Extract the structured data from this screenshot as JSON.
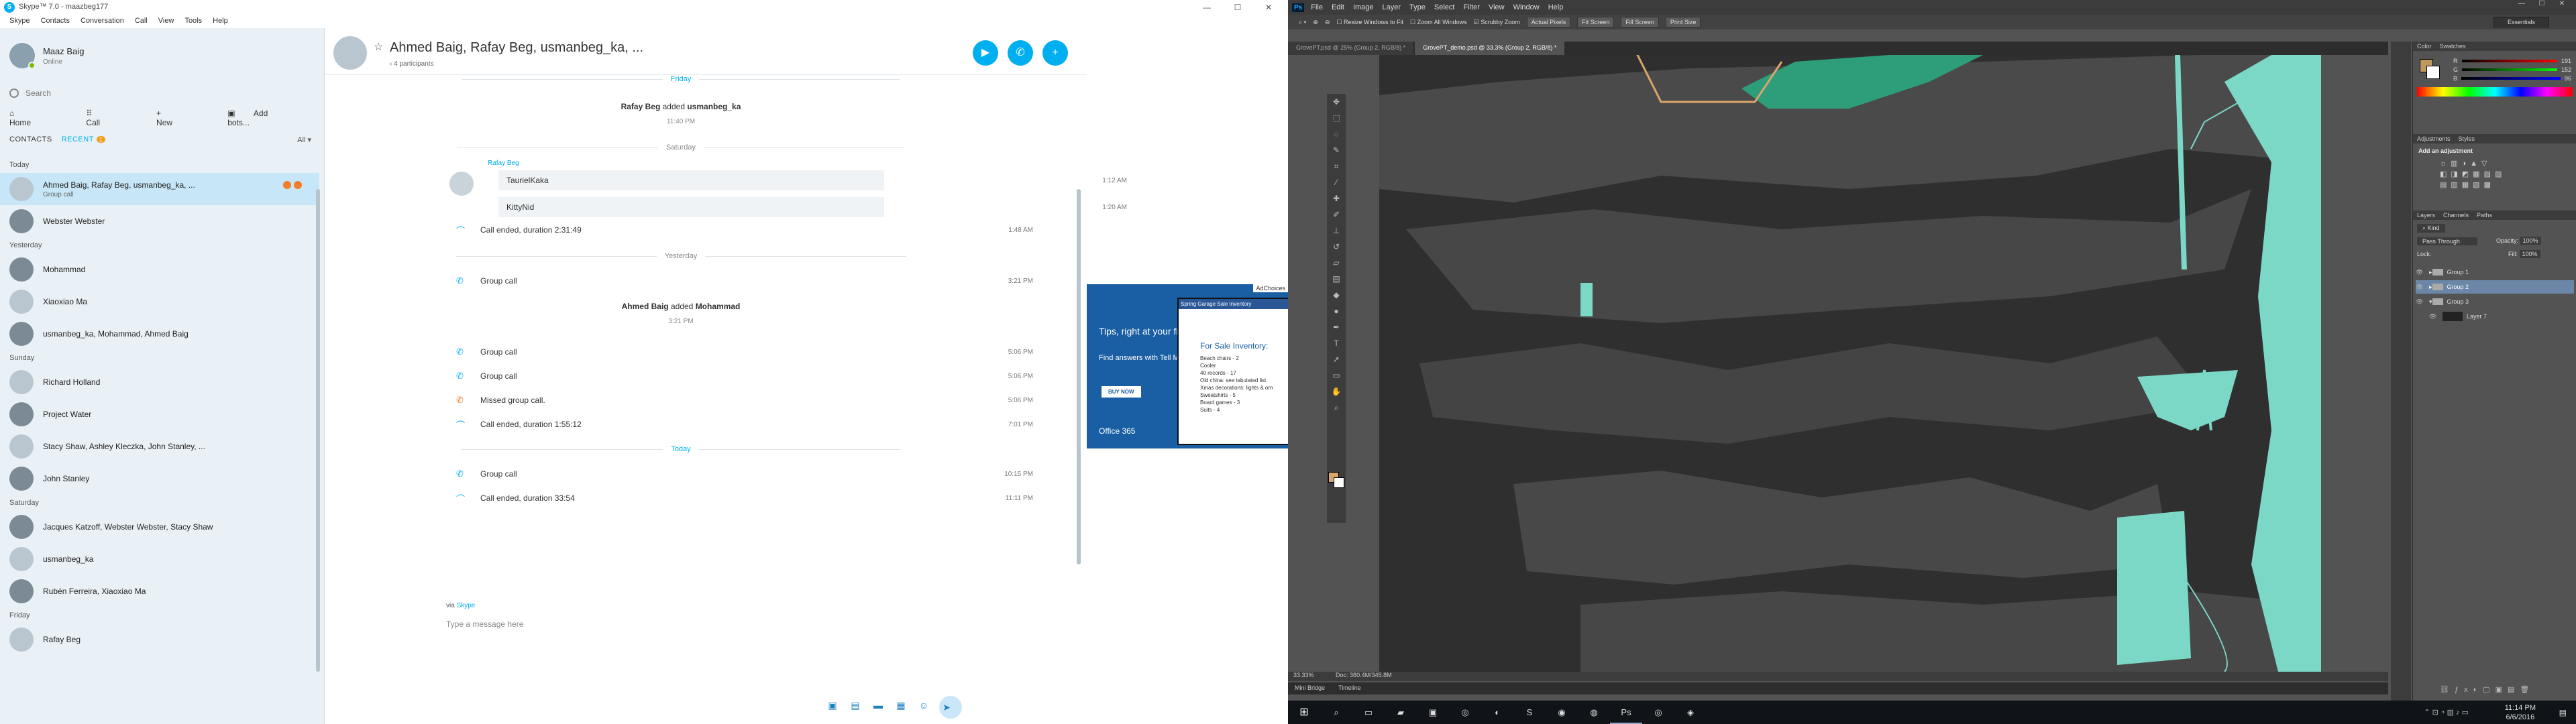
{
  "skype": {
    "window_title": "Skype™ 7.0 - maazbeg177",
    "menu": [
      "Skype",
      "Contacts",
      "Conversation",
      "Call",
      "View",
      "Tools",
      "Help"
    ],
    "profile": {
      "name": "Maaz Baig",
      "status": "Online"
    },
    "search_placeholder": "Search",
    "nav": {
      "home": "Home",
      "call": "Call",
      "new": "New",
      "add_bots": "Add bots..."
    },
    "tabs": {
      "contacts": "CONTACTS",
      "recent": "RECENT",
      "recent_count": "1",
      "filter": "All"
    },
    "sections": [
      {
        "label": "Today",
        "items": [
          {
            "name": "Ahmed Baig, Rafay Beg, usmanbeg_ka, ...",
            "sub": "Group call",
            "selected": true
          },
          {
            "name": "Webster Webster",
            "sub": ""
          }
        ]
      },
      {
        "label": "Yesterday",
        "items": [
          {
            "name": "Mohammad",
            "sub": ""
          },
          {
            "name": "Xiaoxiao Ma",
            "sub": ""
          },
          {
            "name": "usmanbeg_ka, Mohammad, Ahmed Baig",
            "sub": ""
          }
        ]
      },
      {
        "label": "Sunday",
        "items": [
          {
            "name": "Richard Holland",
            "sub": ""
          },
          {
            "name": "Project Water",
            "sub": ""
          },
          {
            "name": "Stacy Shaw, Ashley Kleczka, John Stanley, ...",
            "sub": ""
          },
          {
            "name": "John Stanley",
            "sub": ""
          }
        ]
      },
      {
        "label": "Saturday",
        "items": [
          {
            "name": "Jacques Katzoff, Webster Webster, Stacy Shaw",
            "sub": ""
          },
          {
            "name": "usmanbeg_ka",
            "sub": ""
          },
          {
            "name": "Rubén Ferreira, Xiaoxiao Ma",
            "sub": ""
          }
        ]
      },
      {
        "label": "Friday",
        "items": [
          {
            "name": "Rafay Beg",
            "sub": ""
          }
        ]
      }
    ],
    "chat": {
      "title": "Ahmed Baig, Rafay Beg, usmanbeg_ka, ...",
      "participants": "4 participants",
      "day_friday": "Friday",
      "added1": {
        "who": "Rafay Beg",
        "verb": "added",
        "target": "usmanbeg_ka",
        "time": "11:40 PM"
      },
      "day_saturday": "Saturday",
      "sender": "Rafay Beg",
      "bubble1": {
        "text": "TaurielKaka",
        "time": "1:12 AM"
      },
      "bubble2": {
        "text": "KittyNid",
        "time": "1:20 AM"
      },
      "call1": {
        "text": "Call ended, duration 2:31:49",
        "time": "1:48 AM"
      },
      "day_yesterday": "Yesterday",
      "group1": {
        "text": "Group call",
        "time": "3:21 PM"
      },
      "added2": {
        "who": "Ahmed Baig",
        "verb": "added",
        "target": "Mohammad",
        "time": "3:21 PM"
      },
      "group2": {
        "text": "Group call",
        "time": "5:06 PM"
      },
      "group3": {
        "text": "Group call",
        "time": "5:06 PM"
      },
      "missed": {
        "text": "Missed group call.",
        "time": "5:06 PM"
      },
      "call2": {
        "text": "Call ended, duration 1:55:12",
        "time": "7:01 PM"
      },
      "day_today": "Today",
      "group4": {
        "text": "Group call",
        "time": "10:15 PM"
      },
      "call3": {
        "text": "Call ended, duration 33:54",
        "time": "11:11 PM"
      },
      "via": "via",
      "via_link": "Skype",
      "input_placeholder": "Type a message here"
    },
    "ad": {
      "choices": "AdChoices",
      "tagline": "Tips, right at your fingertips.",
      "sub": "Find answers with Tell Me.",
      "button": "BUY NOW",
      "logo": "Office 365",
      "shot_header": "Spring Garage Sale Inventory",
      "shot_title": "For Sale Inventory:",
      "shot_lines": [
        "Beach chairs - 2",
        "Cooler",
        "40 records - 17",
        "Old china: see tabulated list",
        "Xmas decorations: lights & orn",
        "Sweatshirts - 5",
        "Board games - 3",
        "Suits - 4"
      ]
    }
  },
  "photoshop": {
    "logo": "Ps",
    "menu": [
      "File",
      "Edit",
      "Image",
      "Layer",
      "Type",
      "Select",
      "Filter",
      "View",
      "Window",
      "Help"
    ],
    "options": {
      "resize": "Resize Windows to Fit",
      "zoom_all": "Zoom All Windows",
      "scrubby": "Scrubby Zoom",
      "actual": "Actual Pixels",
      "fit": "Fit Screen",
      "fill": "Fill Screen",
      "print": "Print Size",
      "workspace": "Essentials"
    },
    "doc_tabs": [
      {
        "label": "GrovePT.psd @ 25% (Group 2, RGB/8) *",
        "active": false
      },
      {
        "label": "GrovePT_demo.psd @ 33.3% (Group 2, RGB/8) *",
        "active": true
      }
    ],
    "status": {
      "zoom": "33.33%",
      "doc": "Doc: 380.4M/345.8M"
    },
    "bottom_tabs": [
      "Mini Bridge",
      "Timeline"
    ],
    "panels": {
      "color_tabs": [
        "Color",
        "Swatches"
      ],
      "rgb": {
        "r": "191",
        "g": "152",
        "b": "96"
      },
      "adj_tabs": [
        "Adjustments",
        "Styles"
      ],
      "adj_title": "Add an adjustment",
      "layer_tabs": [
        "Layers",
        "Channels",
        "Paths"
      ],
      "kind": "Kind",
      "blend": "Pass Through",
      "opacity_label": "Opacity:",
      "opacity": "100%",
      "lock_label": "Lock:",
      "fill_label": "Fill:",
      "fill": "100%",
      "layers": [
        {
          "name": "Group 1",
          "selected": false
        },
        {
          "name": "Group 2",
          "selected": true
        },
        {
          "name": "Group 3",
          "selected": false
        },
        {
          "name": "Layer 7",
          "selected": false
        }
      ]
    }
  },
  "taskbar": {
    "time": "11:14 PM",
    "date": "6/6/2016"
  }
}
